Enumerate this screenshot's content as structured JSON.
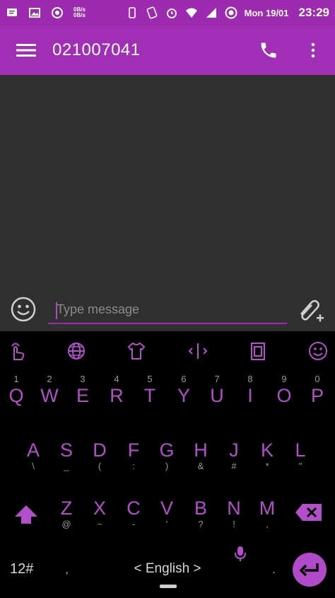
{
  "status_bar": {
    "speed_up": "0B/s",
    "speed_down": "0B/s",
    "date": "Mon 19/01",
    "time": "23:29"
  },
  "app_bar": {
    "title": "021007041",
    "menu_icon": "menu-icon",
    "call_icon": "phone-icon",
    "more_icon": "more-vert-icon"
  },
  "compose": {
    "placeholder": "Type message",
    "emoji_icon": "emoji-icon",
    "attach_icon": "attach-icon"
  },
  "keyboard": {
    "toolbar": [
      "gesture-icon",
      "globe-icon",
      "theme-icon",
      "cursor-icon",
      "clipboard-icon",
      "emoji-icon"
    ],
    "row1": [
      {
        "hint": "1",
        "main": "Q"
      },
      {
        "hint": "2",
        "main": "W"
      },
      {
        "hint": "3",
        "main": "E"
      },
      {
        "hint": "4",
        "main": "R"
      },
      {
        "hint": "5",
        "main": "T"
      },
      {
        "hint": "6",
        "main": "Y"
      },
      {
        "hint": "7",
        "main": "U"
      },
      {
        "hint": "8",
        "main": "I"
      },
      {
        "hint": "9",
        "main": "O"
      },
      {
        "hint": "0",
        "main": "P"
      }
    ],
    "row2": [
      {
        "main": "A",
        "sub": "\\"
      },
      {
        "main": "S",
        "sub": "_"
      },
      {
        "main": "D",
        "sub": "("
      },
      {
        "main": "F",
        "sub": ":"
      },
      {
        "main": "G",
        "sub": ")"
      },
      {
        "main": "H",
        "sub": "&"
      },
      {
        "main": "J",
        "sub": "#"
      },
      {
        "main": "K",
        "sub": "*"
      },
      {
        "main": "L",
        "sub": "\""
      }
    ],
    "row3": [
      {
        "main": "Z",
        "sub": "@"
      },
      {
        "main": "X",
        "sub": "~"
      },
      {
        "main": "C",
        "sub": "-"
      },
      {
        "main": "V",
        "sub": "'"
      },
      {
        "main": "B",
        "sub": "?"
      },
      {
        "main": "N",
        "sub": "!"
      },
      {
        "main": "M",
        "sub": ","
      }
    ],
    "symbols_label": "12#",
    "comma": ",",
    "period": ".",
    "language": "< English >"
  },
  "colors": {
    "accent": "#9c2bb0",
    "key_text": "#b34fc9"
  }
}
